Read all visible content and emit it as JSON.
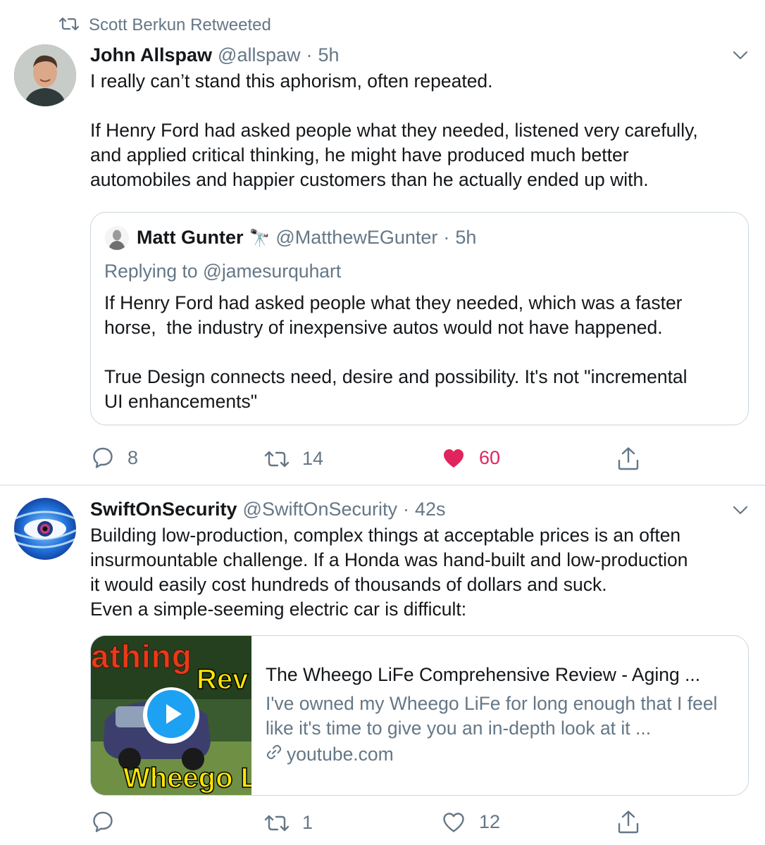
{
  "retweet_header": {
    "text": "Scott Berkun Retweeted"
  },
  "tweet1": {
    "name": "John Allspaw",
    "handle": "@allspaw",
    "sep": "·",
    "time": "5h",
    "text": "I really can’t stand this aphorism, often repeated.\n\nIf Henry Ford had asked people what they needed, listened very carefully,\nand applied critical thinking, he might have produced much better\nautomobiles and happier customers than he actually ended up with.",
    "quote": {
      "name": "Matt Gunter",
      "emoji": "🔭",
      "handle": "@MatthewEGunter",
      "sep": "·",
      "time": "5h",
      "replying": "Replying to @jamesurquhart",
      "text": "If Henry Ford had asked people what they needed, which was a faster\nhorse,  the industry of inexpensive autos would not have happened.\n\nTrue Design connects need, desire and possibility. It's not \"incremental\nUI enhancements\""
    },
    "actions": {
      "replies": "8",
      "retweets": "14",
      "likes": "60",
      "liked": true
    }
  },
  "tweet2": {
    "name": "SwiftOnSecurity",
    "handle": "@SwiftOnSecurity",
    "sep": "·",
    "time": "42s",
    "text": "Building low-production, complex things at acceptable prices is an often\ninsurmountable challenge. If a Honda was hand-built and low-production\nit would easily cost hundreds of thousands of dollars and suck.\nEven a simple-seeming electric car is difficult:",
    "card": {
      "thumb_text_top": "athing",
      "thumb_text_mid": "Rev",
      "thumb_text_bottom": "Wheego L",
      "title": "The Wheego LiFe Comprehensive Review - Aging ...",
      "description": "I've owned my Wheego LiFe for long enough that I feel like it's time to give you an in-depth look at it ...",
      "domain": "youtube.com"
    },
    "actions": {
      "replies": "",
      "retweets": "1",
      "likes": "12",
      "liked": false
    }
  },
  "colors": {
    "like_red": "#e0245e",
    "gray": "#657786",
    "border": "#ccd6dd",
    "play_blue": "#1da1f2"
  },
  "icons": [
    "retweet-icon",
    "chevron-down-icon",
    "reply-icon",
    "heart-icon",
    "share-icon",
    "link-icon",
    "play-icon"
  ]
}
